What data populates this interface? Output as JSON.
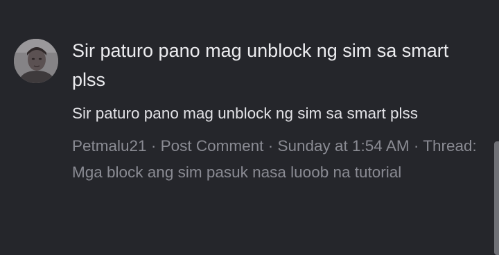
{
  "result": {
    "title": "Sir paturo pano mag unblock ng sim sa smart plss",
    "snippet": "Sir paturo pano mag unblock ng sim sa smart plss",
    "author": "Petmalu21",
    "content_type": "Post Comment",
    "timestamp": "Sunday at 1:54 AM",
    "separator": "·",
    "thread_prefix": "Thread:",
    "thread_title": "Mga block ang sim pasuk nasa luoob na tutorial"
  },
  "avatar": {
    "icon": "user-avatar-photo"
  },
  "colors": {
    "background": "#25262b",
    "title": "#ececef",
    "snippet": "#e2e2e6",
    "meta": "#8a8b93",
    "scrollbar": "#6f7076"
  }
}
